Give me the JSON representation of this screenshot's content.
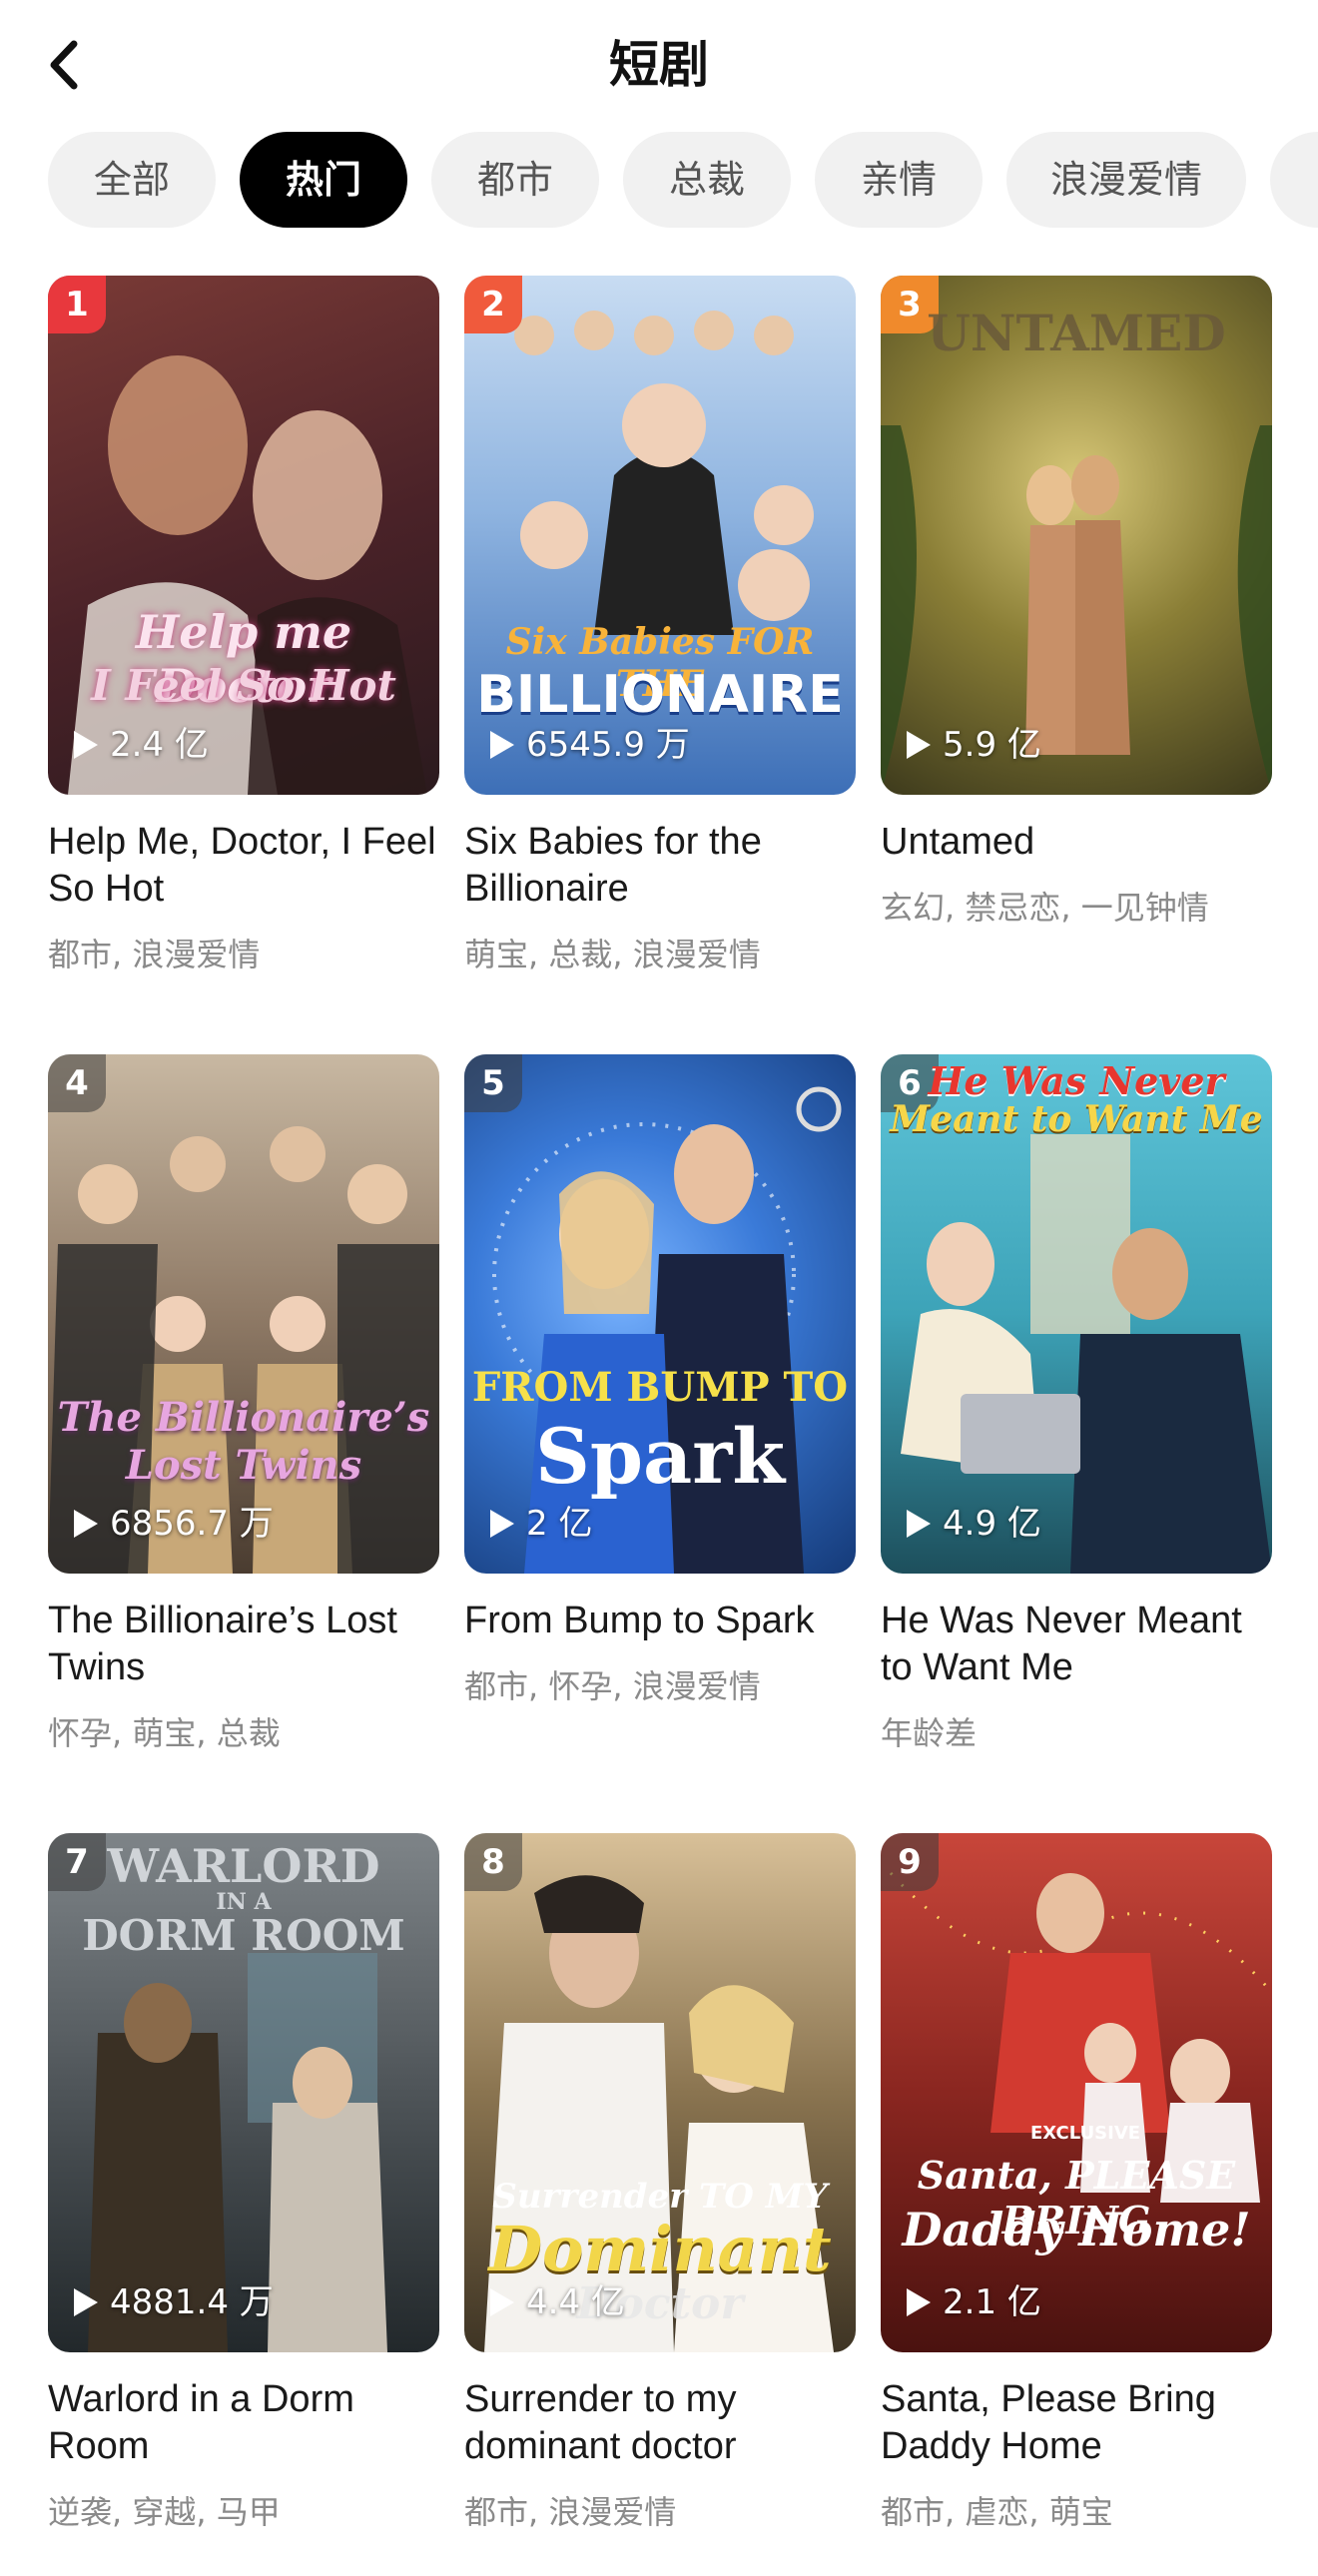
{
  "header": {
    "title": "短剧"
  },
  "tabs": [
    {
      "label": "全部",
      "active": false
    },
    {
      "label": "热门",
      "active": true
    },
    {
      "label": "都市",
      "active": false
    },
    {
      "label": "总裁",
      "active": false
    },
    {
      "label": "亲情",
      "active": false
    },
    {
      "label": "浪漫爱情",
      "active": false
    }
  ],
  "dramas": [
    {
      "rank": "1",
      "views": "2.4 亿",
      "title": "Help Me, Doctor, I Feel So Hot",
      "tags": "都市, 浪漫爱情",
      "poster_text": [
        "Help me Doctor",
        "I Feel So Hot"
      ],
      "rank_color": "#e8383d",
      "poster_colors": [
        "#7a3a36",
        "#2b1a1e"
      ]
    },
    {
      "rank": "2",
      "views": "6545.9 万",
      "title": "Six Babies for the Billionaire",
      "tags": "萌宝, 总裁, 浪漫爱情",
      "poster_text": [
        "Six Babies FOR THE",
        "BILLIONAIRE"
      ],
      "rank_color": "#f05a3c",
      "poster_colors": [
        "#9fc1ea",
        "#3d6fb7"
      ]
    },
    {
      "rank": "3",
      "views": "5.9 亿",
      "title": "Untamed",
      "tags": "玄幻, 禁忌恋, 一见钟情",
      "poster_text": [
        "UNTAMED"
      ],
      "rank_color": "#f08a2c",
      "poster_colors": [
        "#a0913a",
        "#3d3a1c"
      ]
    },
    {
      "rank": "4",
      "views": "6856.7 万",
      "title": "The Billionaire’s Lost Twins",
      "tags": "怀孕, 萌宝, 总裁",
      "poster_text": [
        "The Billionaire’s",
        "Lost Twins"
      ],
      "rank_color": "rgba(60,60,60,0.55)",
      "poster_colors": [
        "#a5907a",
        "#4a3c30"
      ]
    },
    {
      "rank": "5",
      "views": "2 亿",
      "title": "From Bump to Spark",
      "tags": "都市, 怀孕, 浪漫爱情",
      "poster_text": [
        "FROM BUMP TO",
        "Spark"
      ],
      "rank_color": "rgba(60,60,60,0.55)",
      "poster_colors": [
        "#4a8de0",
        "#153a78"
      ]
    },
    {
      "rank": "6",
      "views": "4.9 亿",
      "title": "He Was Never Meant to Want Me",
      "tags": "年龄差",
      "poster_text": [
        "He Was Never",
        "Meant to Want Me"
      ],
      "rank_color": "rgba(60,60,60,0.55)",
      "poster_colors": [
        "#3da3b8",
        "#1d4f5c"
      ]
    },
    {
      "rank": "7",
      "views": "4881.4 万",
      "title": "Warlord in a Dorm Room",
      "tags": "逆袭, 穿越, 马甲",
      "poster_text": [
        "WARLORD",
        "IN A",
        "DORM ROOM"
      ],
      "rank_color": "rgba(60,60,60,0.55)",
      "poster_colors": [
        "#5e6468",
        "#22282b"
      ]
    },
    {
      "rank": "8",
      "views": "4.4 亿",
      "title": "Surrender to my dominant doctor",
      "tags": "都市, 浪漫爱情",
      "poster_text": [
        "Surrender TO MY",
        "Dominant",
        "Doctor"
      ],
      "rank_color": "rgba(60,60,60,0.55)",
      "poster_colors": [
        "#b89a6a",
        "#3e3424"
      ]
    },
    {
      "rank": "9",
      "views": "2.1 亿",
      "title": "Santa, Please Bring Daddy Home",
      "tags": "都市, 虐恋, 萌宝",
      "poster_text": [
        "EXCLUSIVE",
        "Santa, PLEASE BRING",
        "Daddy Home!"
      ],
      "rank_color": "rgba(60,60,60,0.55)",
      "poster_colors": [
        "#b0332c",
        "#4a120f"
      ]
    }
  ]
}
